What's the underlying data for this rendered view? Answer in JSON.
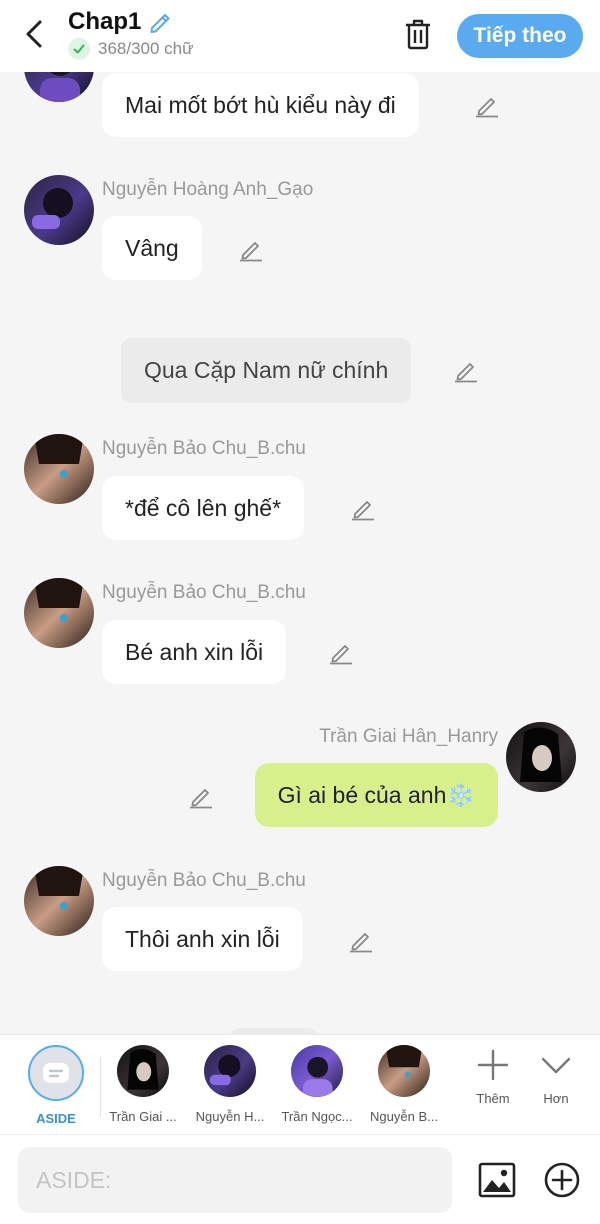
{
  "header": {
    "title": "Chap1",
    "word_count": "368/300 chữ",
    "next_label": "Tiếp theo"
  },
  "messages": [
    {
      "text": "Mai mốt bớt hù kiểu này đi"
    },
    {
      "sender": "Nguyễn Hoàng Anh_Gạo",
      "text": "Vâng"
    },
    {
      "text": "Qua Cặp Nam nữ chính"
    },
    {
      "sender": "Nguyễn Bảo Chu_B.chu",
      "text": "*để cô lên ghế*"
    },
    {
      "sender": "Nguyễn Bảo Chu_B.chu",
      "text": "Bé anh xin lỗi"
    },
    {
      "sender": "Trần Giai Hân_Hanry",
      "text": "Gì ai bé của anh❄️"
    },
    {
      "sender": "Nguyễn Bảo Chu_B.chu",
      "text": "Thôi anh xin lỗi"
    }
  ],
  "characters": {
    "aside_label": "ASIDE",
    "items": [
      {
        "name": "Trần Giai ..."
      },
      {
        "name": "Nguyễn H..."
      },
      {
        "name": "Trần Ngọc..."
      },
      {
        "name": "Nguyễn B..."
      }
    ],
    "add_label": "Thêm",
    "more_label": "Hơn"
  },
  "input": {
    "placeholder": "ASIDE:"
  },
  "colors": {
    "accent": "#5aaaf0",
    "own_bubble": "#d8f08c",
    "narration_bubble": "#ebebeb"
  }
}
